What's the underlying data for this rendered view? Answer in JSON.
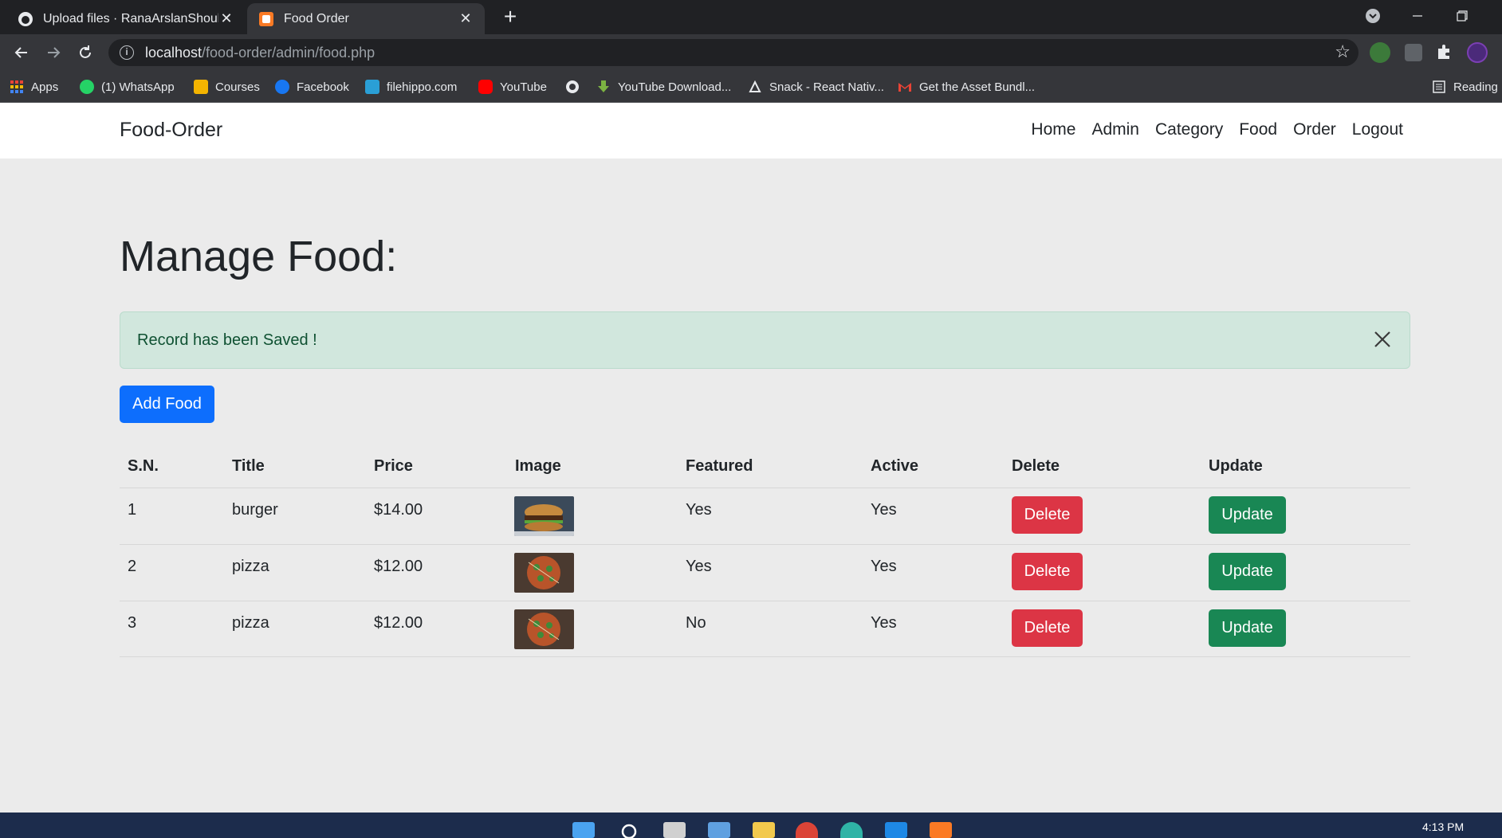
{
  "browser": {
    "tabs": [
      {
        "title": "Upload files · RanaArslanShoukat",
        "close": "✕"
      },
      {
        "title": "Food Order",
        "close": "✕"
      }
    ],
    "new_tab": "+",
    "url_host": "localhost",
    "url_path": "/food-order/admin/food.php",
    "bookmarks": [
      {
        "label": "Apps",
        "icon": "apps-grid-icon",
        "color": "#ea4335"
      },
      {
        "label": "(1) WhatsApp",
        "icon": "whatsapp-icon",
        "color": "#25d366"
      },
      {
        "label": "Courses",
        "icon": "courses-icon",
        "color": "#f4b400"
      },
      {
        "label": "Facebook",
        "icon": "facebook-icon",
        "color": "#1877f2"
      },
      {
        "label": "filehippo.com",
        "icon": "filehippo-icon",
        "color": "#2a9fd6"
      },
      {
        "label": "YouTube",
        "icon": "youtube-icon",
        "color": "#ff0000"
      },
      {
        "label": "",
        "icon": "globe-icon",
        "color": "#e8eaed"
      },
      {
        "label": "YouTube Download...",
        "icon": "download-icon",
        "color": "#7cb342"
      },
      {
        "label": "Snack - React Nativ...",
        "icon": "snack-icon",
        "color": "#e8eaed"
      },
      {
        "label": "Get the Asset Bundl...",
        "icon": "gmail-icon",
        "color": "#ea4335"
      }
    ],
    "reading_list": "Reading"
  },
  "site": {
    "brand": "Food-Order",
    "nav": [
      "Home",
      "Admin",
      "Category",
      "Food",
      "Order",
      "Logout"
    ]
  },
  "main": {
    "heading": "Manage Food:",
    "alert": "Record has been Saved !",
    "add_button": "Add Food",
    "columns": [
      "S.N.",
      "Title",
      "Price",
      "Image",
      "Featured",
      "Active",
      "Delete",
      "Update"
    ],
    "rows": [
      {
        "sn": "1",
        "title": "burger",
        "price": "$14.00",
        "image": "burger-image",
        "featured": "Yes",
        "active": "Yes",
        "delete": "Delete",
        "update": "Update"
      },
      {
        "sn": "2",
        "title": "pizza",
        "price": "$12.00",
        "image": "pizza-image",
        "featured": "Yes",
        "active": "Yes",
        "delete": "Delete",
        "update": "Update"
      },
      {
        "sn": "3",
        "title": "pizza",
        "price": "$12.00",
        "image": "pizza-image",
        "featured": "No",
        "active": "Yes",
        "delete": "Delete",
        "update": "Update"
      }
    ]
  },
  "taskbar": {
    "time": "4:13 PM"
  },
  "colors": {
    "primary": "#0d6efd",
    "danger": "#dc3545",
    "success": "#198754",
    "alert_bg": "#d1e7dd"
  }
}
